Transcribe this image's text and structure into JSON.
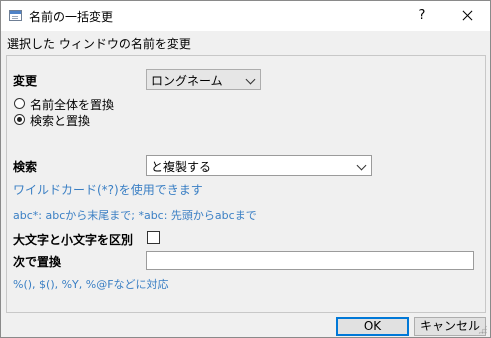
{
  "window": {
    "title": "名前の一括変更",
    "help_label": "?",
    "subtitle": "選択した ウィンドウの名前を変更"
  },
  "change": {
    "label": "変更",
    "selected": "ロングネーム"
  },
  "replace_mode": {
    "options": [
      {
        "label": "名前全体を置換",
        "checked": false
      },
      {
        "label": "検索と置換",
        "checked": true
      }
    ]
  },
  "search": {
    "label": "検索",
    "value": "と複製する",
    "hint_wildcard": "ワイルドカード(*?)を使用できます",
    "hint_example": "abc*: abcから末尾まで; *abc: 先頭からabcまで"
  },
  "case_sensitive": {
    "label": "大文字と小文字を区別",
    "checked": false
  },
  "replace_with": {
    "label": "次で置換",
    "value": "",
    "hint": "%(), $(), %Y, %@Fなどに対応"
  },
  "buttons": {
    "ok_label": "OK",
    "cancel_label": "キャンセル"
  },
  "colors": {
    "hint_text": "#3a7fc4",
    "default_button_border": "#0078d7",
    "title_icon": "#4f83c7"
  }
}
